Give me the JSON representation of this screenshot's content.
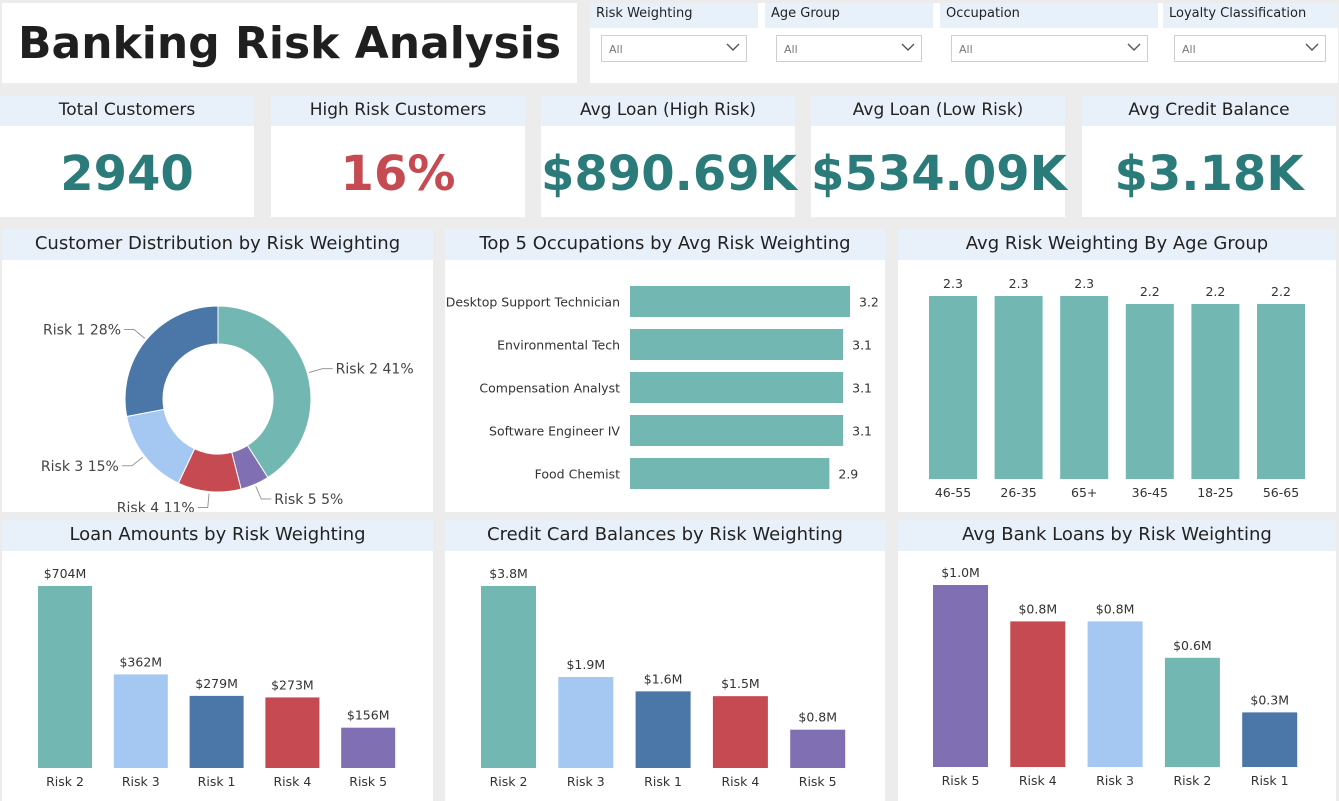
{
  "title": "Banking Risk Analysis",
  "filters": [
    {
      "label": "Risk Weighting",
      "value": "All"
    },
    {
      "label": "Age Group",
      "value": "All"
    },
    {
      "label": "Occupation",
      "value": "All"
    },
    {
      "label": "Loyalty Classification",
      "value": "All"
    }
  ],
  "kpis": [
    {
      "label": "Total Customers",
      "value": "2940"
    },
    {
      "label": "High Risk Customers",
      "value": "16%"
    },
    {
      "label": "Avg Loan (High Risk)",
      "value": "$890.69K"
    },
    {
      "label": "Avg Loan (Low Risk)",
      "value": "$534.09K"
    },
    {
      "label": "Avg Credit Balance",
      "value": "$3.18K"
    }
  ],
  "colors": {
    "teal": "#72b7b2",
    "lightblue": "#a4c8f2",
    "darkblue": "#4a76a8",
    "red": "#c64a52",
    "purple": "#8070b3",
    "kpi_teal": "#2b7b7b",
    "header_bg": "#e8f1fa"
  },
  "chart_data": [
    {
      "title": "Customer Distribution by Risk Weighting",
      "type": "pie",
      "donut": true,
      "slices": [
        {
          "name": "Risk 2",
          "value": 41,
          "label": "Risk 2 41%",
          "color": "#72b7b2"
        },
        {
          "name": "Risk 5",
          "value": 5,
          "label": "Risk 5 5%",
          "color": "#8070b3"
        },
        {
          "name": "Risk 4",
          "value": 11,
          "label": "Risk 4 11%",
          "color": "#c64a52"
        },
        {
          "name": "Risk 3",
          "value": 15,
          "label": "Risk 3 15%",
          "color": "#a4c8f2"
        },
        {
          "name": "Risk 1",
          "value": 28,
          "label": "Risk 1 28%",
          "color": "#4a76a8"
        }
      ]
    },
    {
      "title": "Top 5 Occupations by Avg Risk Weighting",
      "type": "bar",
      "orientation": "horizontal",
      "categories": [
        "Desktop Support Technician",
        "Environmental Tech",
        "Compensation Analyst",
        "Software Engineer IV",
        "Food Chemist"
      ],
      "values": [
        3.2,
        3.1,
        3.1,
        3.1,
        2.9
      ],
      "labels": [
        "3.2",
        "3.1",
        "3.1",
        "3.1",
        "2.9"
      ]
    },
    {
      "title": "Avg Risk Weighting By Age Group",
      "type": "bar",
      "categories": [
        "46-55",
        "26-35",
        "65+",
        "36-45",
        "18-25",
        "56-65"
      ],
      "values": [
        2.3,
        2.3,
        2.3,
        2.2,
        2.2,
        2.2
      ],
      "labels": [
        "2.3",
        "2.3",
        "2.3",
        "2.2",
        "2.2",
        "2.2"
      ]
    },
    {
      "title": "Loan Amounts by Risk Weighting",
      "type": "bar",
      "categories": [
        "Risk 2",
        "Risk 3",
        "Risk 1",
        "Risk 4",
        "Risk 5"
      ],
      "values": [
        704,
        362,
        279,
        273,
        156
      ],
      "labels": [
        "$704M",
        "$362M",
        "$279M",
        "$273M",
        "$156M"
      ],
      "colors": [
        "#72b7b2",
        "#a4c8f2",
        "#4a76a8",
        "#c64a52",
        "#8070b3"
      ]
    },
    {
      "title": "Credit Card Balances by Risk Weighting",
      "type": "bar",
      "categories": [
        "Risk 2",
        "Risk 3",
        "Risk 1",
        "Risk 4",
        "Risk 5"
      ],
      "values": [
        3.8,
        1.9,
        1.6,
        1.5,
        0.8
      ],
      "labels": [
        "$3.8M",
        "$1.9M",
        "$1.6M",
        "$1.5M",
        "$0.8M"
      ],
      "colors": [
        "#72b7b2",
        "#a4c8f2",
        "#4a76a8",
        "#c64a52",
        "#8070b3"
      ]
    },
    {
      "title": "Avg Bank Loans by Risk Weighting",
      "type": "bar",
      "categories": [
        "Risk 5",
        "Risk 4",
        "Risk 3",
        "Risk 2",
        "Risk 1"
      ],
      "values": [
        1.0,
        0.8,
        0.8,
        0.6,
        0.3
      ],
      "labels": [
        "$1.0M",
        "$0.8M",
        "$0.8M",
        "$0.6M",
        "$0.3M"
      ],
      "colors": [
        "#8070b3",
        "#c64a52",
        "#a4c8f2",
        "#72b7b2",
        "#4a76a8"
      ]
    }
  ]
}
